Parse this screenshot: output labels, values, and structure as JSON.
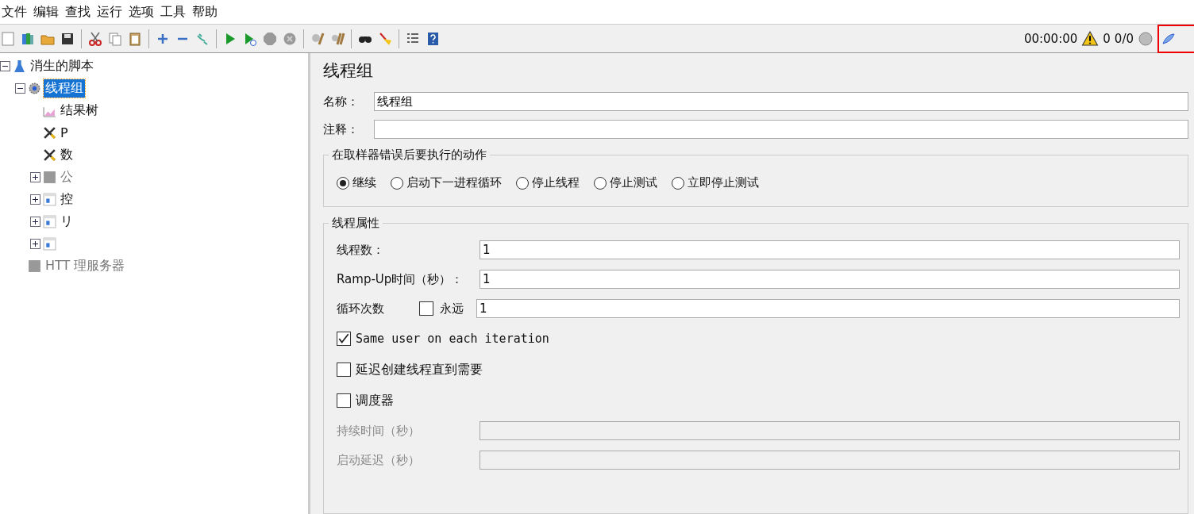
{
  "menu": [
    "文件",
    "编辑",
    "查找",
    "运行",
    "选项",
    "工具",
    "帮助"
  ],
  "status": {
    "time": "00:00:00",
    "warnings": "0",
    "threads": "0/0"
  },
  "tree": {
    "label": "消生的脚本",
    "expanded": true,
    "kind": "plan",
    "children": [
      {
        "label": "线程组",
        "kind": "threadgroup",
        "expanded": true,
        "selected": true,
        "children": [
          {
            "label": "结果树",
            "kind": "listener"
          },
          {
            "label": "P",
            "kind": "config"
          },
          {
            "label": "数",
            "kind": "config"
          },
          {
            "label": "公",
            "kind": "disabled-controller",
            "expanded": false
          },
          {
            "label": "控",
            "kind": "controller",
            "expanded": false
          },
          {
            "label": "リ",
            "kind": "controller",
            "expanded": false
          },
          {
            "kind": "controller",
            "expanded": false
          }
        ]
      },
      {
        "label": "HTT 理服务器",
        "kind": "disabled-item"
      }
    ]
  },
  "panel": {
    "title": "线程组",
    "name_label": "名称：",
    "name_value": "线程组",
    "comment_label": "注释：",
    "error_group": {
      "title": "在取样器错误后要执行的动作",
      "options": [
        {
          "label": "继续",
          "selected": true
        },
        {
          "label": "启动下一进程循环",
          "selected": false
        },
        {
          "label": "停止线程",
          "selected": false
        },
        {
          "label": "停止测试",
          "selected": false
        },
        {
          "label": "立即停止测试",
          "selected": false
        }
      ]
    },
    "props": {
      "title": "线程属性",
      "threads_label": "线程数：",
      "threads_value": "1",
      "rampup_label": "Ramp-Up时间（秒）：",
      "rampup_value": "1",
      "loop_label": "循环次数",
      "forever_label": "永远",
      "forever_checked": false,
      "loop_value": "1",
      "checks": [
        {
          "label": "Same user on each iteration",
          "checked": true,
          "mono": true
        },
        {
          "label": "延迟创建线程直到需要",
          "checked": false,
          "mono": false
        },
        {
          "label": "调度器",
          "checked": false,
          "mono": false
        }
      ],
      "duration_label": "持续时间（秒）",
      "duration_disabled": true,
      "delay_label": "启动延迟（秒）",
      "delay_disabled": true
    }
  }
}
